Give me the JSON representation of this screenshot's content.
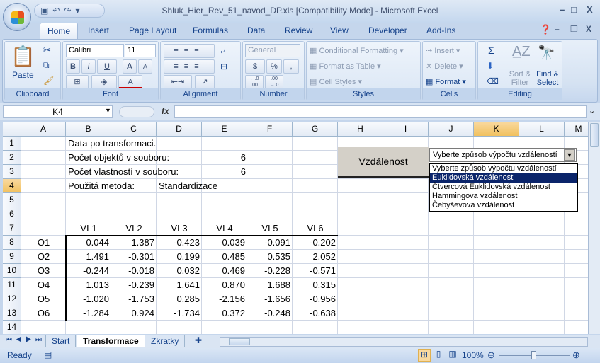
{
  "window": {
    "title": "Shluk_Hier_Rev_51_navod_DP.xls  [Compatibility Mode] - Microsoft Excel",
    "minimize": "–",
    "restore": "□",
    "close": "X"
  },
  "qat": {
    "icons": [
      "save-icon",
      "undo-icon",
      "redo-icon",
      "customize-icon"
    ]
  },
  "tabs": [
    {
      "label": "Home",
      "active": true
    },
    {
      "label": "Insert"
    },
    {
      "label": "Page Layout"
    },
    {
      "label": "Formulas"
    },
    {
      "label": "Data"
    },
    {
      "label": "Review"
    },
    {
      "label": "View"
    },
    {
      "label": "Developer"
    },
    {
      "label": "Add-Ins"
    }
  ],
  "ribbon": {
    "clipboard": {
      "label": "Clipboard",
      "paste": "Paste"
    },
    "font": {
      "label": "Font",
      "name": "Calibri",
      "size": "11",
      "bold": "B",
      "italic": "I",
      "underline": "U",
      "grow": "A",
      "shrink": "A",
      "color": "A"
    },
    "alignment": {
      "label": "Alignment"
    },
    "number": {
      "label": "Number",
      "format": "General",
      "currency": "$",
      "percent": "%",
      "comma": ",",
      "inc": "←.0 .00",
      "dec": ".00 →.0"
    },
    "styles": {
      "label": "Styles",
      "conditional": "Conditional Formatting",
      "format_table": "Format as Table",
      "cell_styles": "Cell Styles"
    },
    "cells": {
      "label": "Cells",
      "insert": "Insert",
      "delete": "Delete",
      "format": "Format"
    },
    "editing": {
      "label": "Editing",
      "sum": "Σ",
      "sort": "Sort & Filter",
      "find": "Find & Select"
    }
  },
  "formula_bar": {
    "name_box": "K4",
    "fx": "fx",
    "formula": ""
  },
  "columns": [
    "A",
    "B",
    "C",
    "D",
    "E",
    "F",
    "G",
    "H",
    "I",
    "J",
    "K",
    "L",
    "M"
  ],
  "selected_column": "K",
  "selected_row": 4,
  "rows": [
    1,
    2,
    3,
    4,
    5,
    6,
    7,
    8,
    9,
    10,
    11,
    12,
    13,
    14
  ],
  "sheet": {
    "r1": "Data po transformaci.",
    "r2_label": "Počet objektů v souboru:",
    "r2_value": "6",
    "r3_label": "Počet vlastností v souboru:",
    "r3_value": "6",
    "r4_label": "Použitá metoda:",
    "r4_value": "Standardizace",
    "headers": [
      "VL1",
      "VL2",
      "VL3",
      "VL4",
      "VL5",
      "VL6"
    ],
    "objects": [
      "O1",
      "O2",
      "O3",
      "O4",
      "O5",
      "O6"
    ],
    "values": [
      [
        "0.044",
        "1.387",
        "-0.423",
        "-0.039",
        "-0.091",
        "-0.202"
      ],
      [
        "1.491",
        "-0.301",
        "0.199",
        "0.485",
        "0.535",
        "2.052"
      ],
      [
        "-0.244",
        "-0.018",
        "0.032",
        "0.469",
        "-0.228",
        "-0.571"
      ],
      [
        "1.013",
        "-0.239",
        "1.641",
        "0.870",
        "1.688",
        "0.315"
      ],
      [
        "-1.020",
        "-1.753",
        "0.285",
        "-2.156",
        "-1.656",
        "-0.956"
      ],
      [
        "-1.284",
        "0.924",
        "-1.734",
        "0.372",
        "-0.248",
        "-0.638"
      ]
    ]
  },
  "button_vzdalenost": "Vzdálenost",
  "combo": {
    "value": "Vyberte způsob výpočtu vzdáleností",
    "options": [
      "Vyberte způsob výpočtu vzdáleností",
      "Euklidovská vzdálenost",
      "Čtvercová Euklidovská vzdálenost",
      "Hammingova vzdálenost",
      "Čebyševova vzdálenost"
    ],
    "highlighted": 1
  },
  "sheet_tabs": [
    {
      "label": "Start"
    },
    {
      "label": "Transformace",
      "active": true
    },
    {
      "label": "Zkratky"
    }
  ],
  "status": {
    "ready": "Ready",
    "zoom": "100%",
    "zoom_level": 100
  }
}
